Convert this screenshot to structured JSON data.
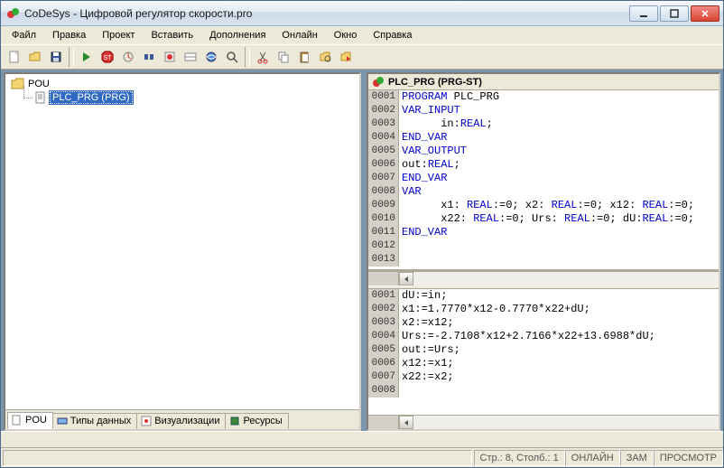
{
  "title": "CoDeSys - Цифровой регулятор скорости.pro",
  "menu": [
    "Файл",
    "Правка",
    "Проект",
    "Вставить",
    "Дополнения",
    "Онлайн",
    "Окно",
    "Справка"
  ],
  "tree": {
    "root": "POU",
    "item": "PLC_PRG (PRG)"
  },
  "bottom_tabs": [
    "POU",
    "Типы данных",
    "Визуализации",
    "Ресурсы"
  ],
  "editor_title": "PLC_PRG (PRG-ST)",
  "code_top": [
    {
      "n": "0001",
      "seg": [
        {
          "t": "PROGRAM",
          "k": 1
        },
        {
          "t": " PLC_PRG"
        }
      ]
    },
    {
      "n": "0002",
      "seg": [
        {
          "t": "VAR_INPUT",
          "k": 1
        }
      ]
    },
    {
      "n": "0003",
      "seg": [
        {
          "t": "      in:"
        },
        {
          "t": "REAL",
          "k": 1
        },
        {
          "t": ";"
        }
      ]
    },
    {
      "n": "0004",
      "seg": [
        {
          "t": "END_VAR",
          "k": 1
        }
      ]
    },
    {
      "n": "0005",
      "seg": [
        {
          "t": "VAR_OUTPUT",
          "k": 1
        }
      ]
    },
    {
      "n": "0006",
      "seg": [
        {
          "t": "out:"
        },
        {
          "t": "REAL",
          "k": 1
        },
        {
          "t": ";"
        }
      ]
    },
    {
      "n": "0007",
      "seg": [
        {
          "t": "END_VAR",
          "k": 1
        }
      ]
    },
    {
      "n": "0008",
      "seg": [
        {
          "t": "VAR",
          "k": 1
        }
      ]
    },
    {
      "n": "0009",
      "seg": [
        {
          "t": "      x1: "
        },
        {
          "t": "REAL",
          "k": 1
        },
        {
          "t": ":=0; x2: "
        },
        {
          "t": "REAL",
          "k": 1
        },
        {
          "t": ":=0; x12: "
        },
        {
          "t": "REAL",
          "k": 1
        },
        {
          "t": ":=0;"
        }
      ]
    },
    {
      "n": "0010",
      "seg": [
        {
          "t": "      x22: "
        },
        {
          "t": "REAL",
          "k": 1
        },
        {
          "t": ":=0; Urs: "
        },
        {
          "t": "REAL",
          "k": 1
        },
        {
          "t": ":=0; dU:"
        },
        {
          "t": "REAL",
          "k": 1
        },
        {
          "t": ":=0;"
        }
      ]
    },
    {
      "n": "0011",
      "seg": [
        {
          "t": "END_VAR",
          "k": 1
        }
      ]
    },
    {
      "n": "0012",
      "seg": []
    },
    {
      "n": "0013",
      "seg": []
    }
  ],
  "code_bottom": [
    {
      "n": "0001",
      "seg": [
        {
          "t": "dU:=in;"
        }
      ]
    },
    {
      "n": "0002",
      "seg": [
        {
          "t": "x1:=1.7770*x12-0.7770*x22+dU;"
        }
      ]
    },
    {
      "n": "0003",
      "seg": [
        {
          "t": "x2:=x12;"
        }
      ]
    },
    {
      "n": "0004",
      "seg": [
        {
          "t": "Urs:=-2.7108*x12+2.7166*x22+13.6988*dU;"
        }
      ]
    },
    {
      "n": "0005",
      "seg": [
        {
          "t": "out:=Urs;"
        }
      ]
    },
    {
      "n": "0006",
      "seg": [
        {
          "t": "x12:=x1;"
        }
      ]
    },
    {
      "n": "0007",
      "seg": [
        {
          "t": "x22:=x2;"
        }
      ]
    },
    {
      "n": "0008",
      "seg": []
    }
  ],
  "status": {
    "pos": "Стр.: 8, Столб.: 1",
    "online": "ОНЛАЙН",
    "ovr": "ЗАМ",
    "view": "ПРОСМОТР"
  }
}
